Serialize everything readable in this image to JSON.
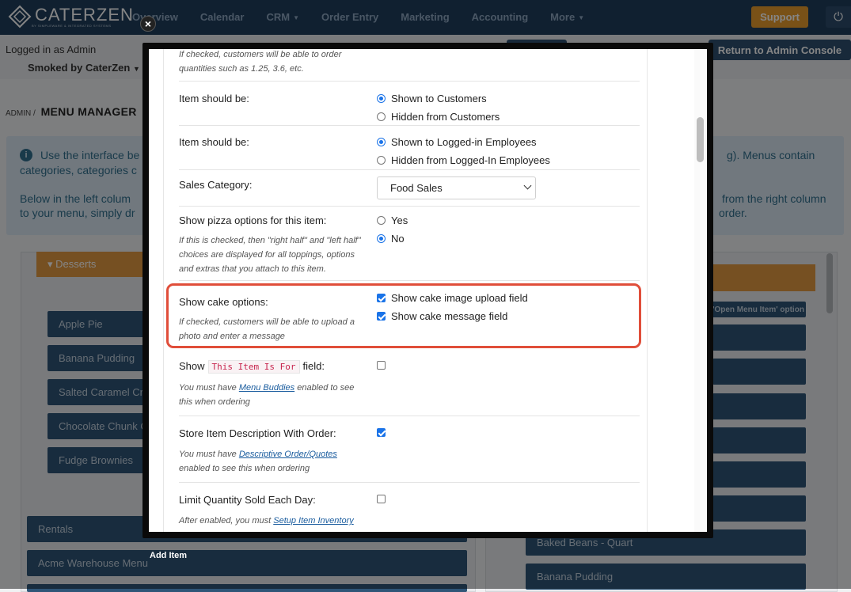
{
  "brand": {
    "name": "CATERZEN",
    "tagline": "BY SIMPLEWARE & INTEGRATED SYSTEMS"
  },
  "nav": {
    "links": [
      {
        "label": "Overview",
        "caret": false
      },
      {
        "label": "Calendar",
        "caret": false
      },
      {
        "label": "CRM",
        "caret": true
      },
      {
        "label": "Order Entry",
        "caret": false
      },
      {
        "label": "Marketing",
        "caret": false
      },
      {
        "label": "Accounting",
        "caret": false
      },
      {
        "label": "More",
        "caret": true
      }
    ],
    "support_label": "Support",
    "power_icon": "power-icon"
  },
  "subbar": {
    "logged_in": "Logged in as Admin",
    "store": "Smoked by CaterZen",
    "return_label": "Return to Admin Console"
  },
  "breadcrumb": {
    "root": "ADMIN",
    "sep": "/",
    "current": "MENU MANAGER"
  },
  "info": {
    "l1": "Use the interface be",
    "l2": "categories, categories c",
    "l3": "Below in the left colum",
    "l4": "to your menu, simply dr",
    "r1": "g). Menus contain",
    "r2": "from the right column",
    "r3": "order."
  },
  "left_panel": {
    "category": "Desserts",
    "items": [
      "Apple Pie",
      "Banana Pudding",
      "Salted Caramel Cr",
      "Chocolate Chunk C",
      "Fudge Brownies"
    ],
    "menus": [
      "Rentals",
      "Acme Warehouse Menu"
    ]
  },
  "right_panel": {
    "open_option": "'Open Menu Item' option",
    "items": [
      "Baked Beans - Quart",
      "Banana Pudding"
    ]
  },
  "modal": {
    "footer_label": "Add Item",
    "close_symbol": "×",
    "top_help_1": "If checked, customers will be able to order",
    "top_help_2": "quantities such as 1.25, 3.6, etc.",
    "visibility_customers": {
      "label": "Item should be:",
      "options": [
        {
          "label": "Shown to Customers",
          "selected": true
        },
        {
          "label": "Hidden from Customers",
          "selected": false
        }
      ]
    },
    "visibility_employees": {
      "label": "Item should be:",
      "options": [
        {
          "label": "Shown to Logged-in Employees",
          "selected": true
        },
        {
          "label": "Hidden from Logged-In Employees",
          "selected": false
        }
      ]
    },
    "sales_category": {
      "label": "Sales Category:",
      "value": "Food Sales"
    },
    "pizza": {
      "label": "Show pizza options for this item:",
      "help_1": "If this is checked, then \"right half\" and \"left half\"",
      "help_2": "choices are displayed for all toppings, options",
      "help_3": "and extras that you attach to this item.",
      "options": [
        {
          "label": "Yes",
          "selected": false
        },
        {
          "label": "No",
          "selected": true
        }
      ]
    },
    "cake": {
      "label": "Show cake options:",
      "help_1": "If checked, customers will be able to upload a",
      "help_2": "photo and enter a message",
      "options": [
        {
          "label": "Show cake image upload field",
          "checked": true
        },
        {
          "label": "Show cake message field",
          "checked": true
        }
      ]
    },
    "this_item_for": {
      "label_pre": "Show",
      "code": "This Item Is For",
      "label_post": "field:",
      "help_pre": "You must have ",
      "help_link": "Menu Buddies",
      "help_post": " enabled to see",
      "help_2": "this when ordering",
      "checked": false
    },
    "store_description": {
      "label": "Store Item Description With Order:",
      "help_pre": "You must have ",
      "help_link": "Descriptive Order/Quotes",
      "help_2": "enabled to see this when ordering",
      "checked": true
    },
    "limit_quantity": {
      "label": "Limit Quantity Sold Each Day:",
      "help_pre": "After enabled, you must ",
      "help_link": "Setup Item Inventory",
      "checked": false
    }
  },
  "colors": {
    "nav_bg": "#1f3e5c",
    "accent_orange": "#e89b2c",
    "highlight": "#e04e3a",
    "control_blue": "#1a73e8"
  }
}
